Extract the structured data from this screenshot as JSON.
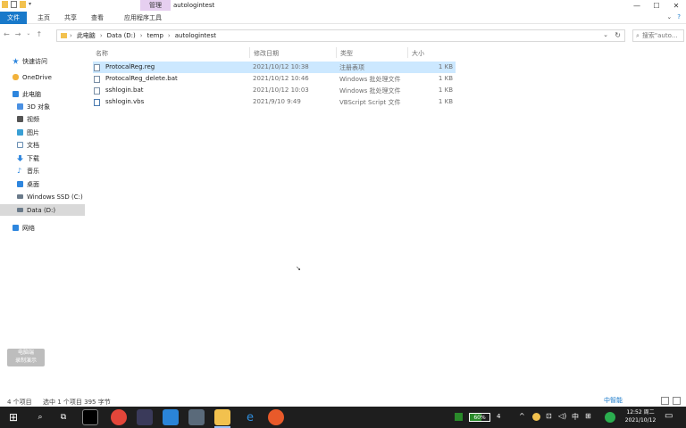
{
  "window": {
    "title": "autologintest",
    "manage_tab": "管理",
    "controls": [
      "—",
      "☐",
      "✕"
    ]
  },
  "ribbon": {
    "tabs": [
      "文件",
      "主页",
      "共享",
      "查看",
      "应用程序工具"
    ],
    "help": "?"
  },
  "address": {
    "segments": [
      "此电脑",
      "Data (D:)",
      "temp",
      "autologintest"
    ],
    "search_placeholder": "搜索\"auto...",
    "separator": "›"
  },
  "sidebar": {
    "items": [
      {
        "label": "快速访问",
        "icon": "star-icon",
        "color": "#2e86de"
      },
      {
        "label": "OneDrive",
        "icon": "cloud-icon",
        "color": "#f2b23b"
      },
      {
        "label": "此电脑",
        "icon": "computer-icon",
        "color": "#2e86de"
      },
      {
        "label": "3D 对象",
        "icon": "cube-icon",
        "color": "#4a90e2"
      },
      {
        "label": "视频",
        "icon": "video-icon",
        "color": "#555555"
      },
      {
        "label": "图片",
        "icon": "picture-icon",
        "color": "#3aa0d5"
      },
      {
        "label": "文档",
        "icon": "document-icon",
        "color": "#6a8fb3"
      },
      {
        "label": "下载",
        "icon": "download-icon",
        "color": "#2e86de"
      },
      {
        "label": "音乐",
        "icon": "music-icon",
        "color": "#2e86de"
      },
      {
        "label": "桌面",
        "icon": "desktop-icon",
        "color": "#2e86de"
      },
      {
        "label": "Windows SSD (C:)",
        "icon": "drive-icon",
        "color": "#6a7a8a"
      },
      {
        "label": "Data (D:)",
        "icon": "drive-icon",
        "color": "#6a7a8a"
      },
      {
        "label": "网络",
        "icon": "network-icon",
        "color": "#2e86de"
      }
    ]
  },
  "columns": {
    "name": "名称",
    "date": "修改日期",
    "type": "类型",
    "size": "大小"
  },
  "files": [
    {
      "name": "ProtocalReg.reg",
      "date": "2021/10/12 10:38",
      "type": "注册表项",
      "size": "1 KB",
      "selected": true
    },
    {
      "name": "ProtocalReg_delete.bat",
      "date": "2021/10/12 10:46",
      "type": "Windows 批处理文件",
      "size": "1 KB",
      "selected": false
    },
    {
      "name": "sshlogin.bat",
      "date": "2021/10/12 10:03",
      "type": "Windows 批处理文件",
      "size": "1 KB",
      "selected": false
    },
    {
      "name": "sshlogin.vbs",
      "date": "2021/9/10 9:49",
      "type": "VBScript Script 文件",
      "size": "1 KB",
      "selected": false
    }
  ],
  "status": {
    "count": "4 个项目",
    "selection": "选中 1 个项目  395 字节"
  },
  "watermark": {
    "line1": "电脑端",
    "line2": "录制演示"
  },
  "taskbar": {
    "battery_percent": 60,
    "battery_label": "60%",
    "battery_icon_digit": "4",
    "time": "12:52 周二",
    "date": "2021/10/12",
    "ime_label": "中智能"
  }
}
